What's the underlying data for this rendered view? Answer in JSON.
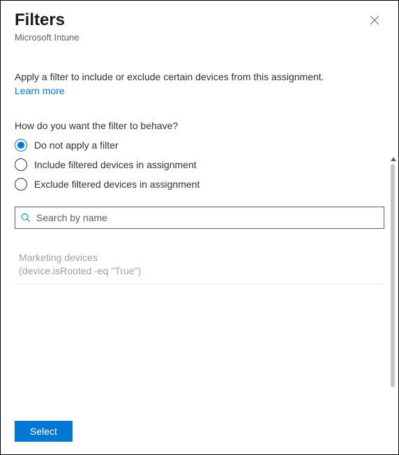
{
  "header": {
    "title": "Filters",
    "subtitle": "Microsoft Intune"
  },
  "intro": {
    "text": "Apply a filter to include or exclude certain devices from this assignment.",
    "learn_more": "Learn more"
  },
  "question": "How do you want the filter to behave?",
  "radios": [
    {
      "label": "Do not apply a filter",
      "selected": true
    },
    {
      "label": "Include filtered devices in assignment",
      "selected": false
    },
    {
      "label": "Exclude filtered devices in assignment",
      "selected": false
    }
  ],
  "search": {
    "placeholder": "Search by name",
    "value": ""
  },
  "filters_list": [
    {
      "name": "Marketing devices",
      "rule": "(device.isRooted -eq \"True\")"
    }
  ],
  "footer": {
    "select_label": "Select"
  }
}
